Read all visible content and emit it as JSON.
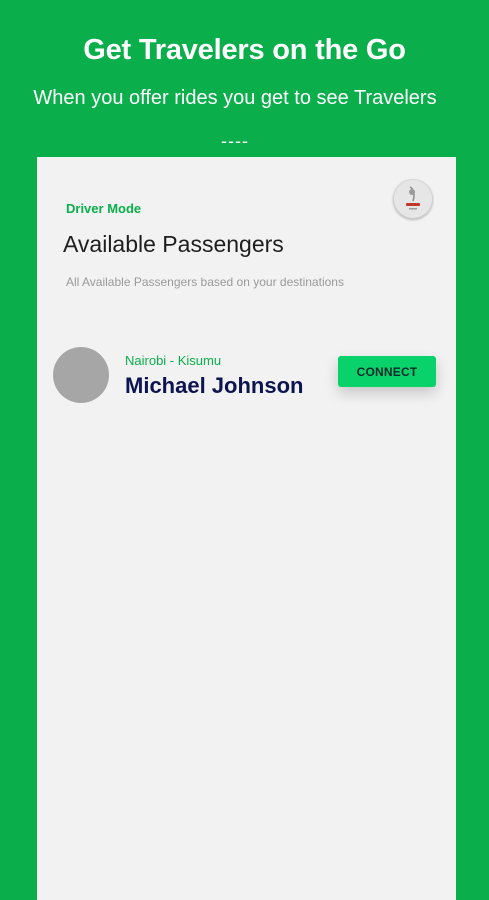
{
  "promo": {
    "title": "Get Travelers on the Go",
    "subtitle": "When you offer rides you get to see Travelers",
    "divider": "----"
  },
  "screen": {
    "mode_label": "Driver Mode",
    "title": "Available Passengers",
    "subtitle": "All Available Passengers based on your destinations",
    "profile_avatar_icon": "user-avatar-icon"
  },
  "passengers": [
    {
      "route": "Nairobi - Kisumu",
      "name": "Michael Johnson",
      "action_label": "CONNECT"
    }
  ],
  "colors": {
    "background": "#0aaf4b",
    "accent": "#0aaf4b",
    "button": "#0ad26a",
    "name_text": "#0d1450",
    "screen_bg": "#f2f2f2"
  }
}
